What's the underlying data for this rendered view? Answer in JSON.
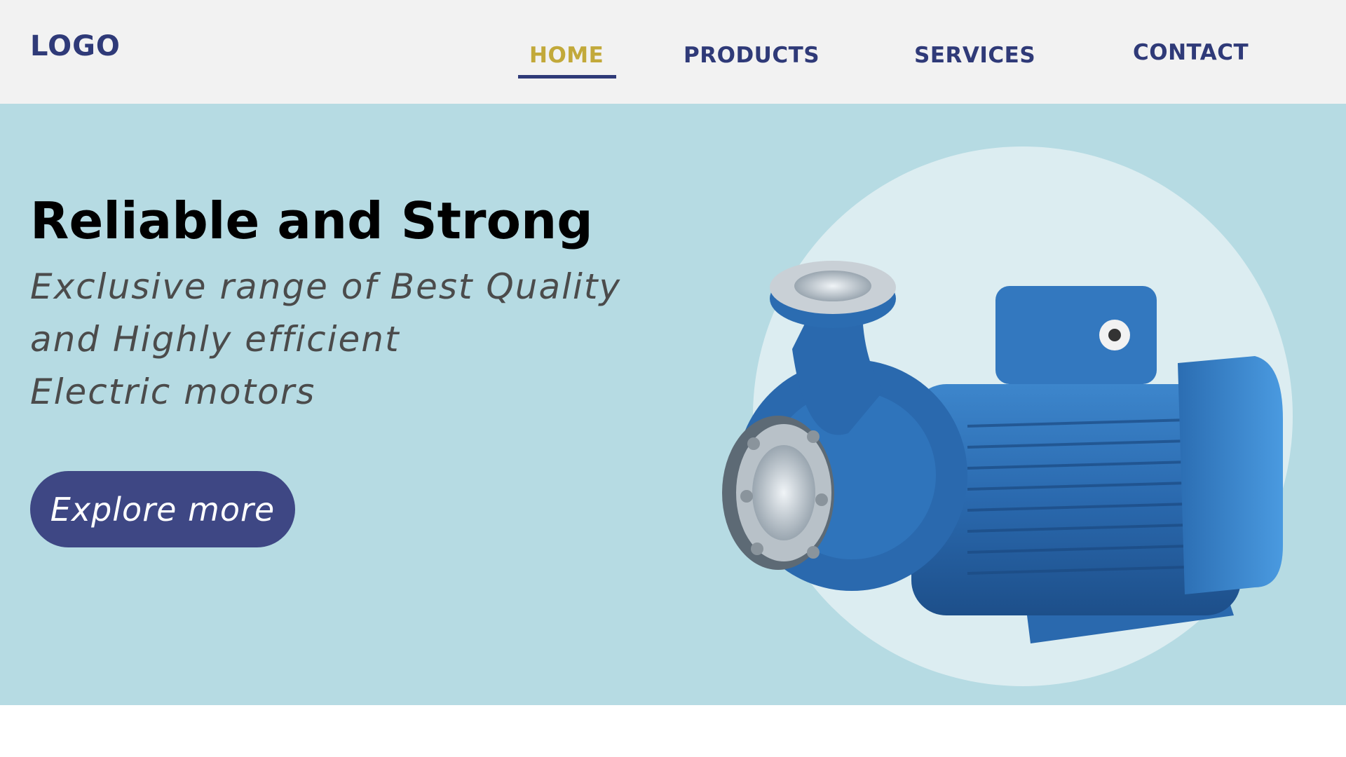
{
  "header": {
    "logo": "LOGO",
    "nav": [
      {
        "label": "HOME",
        "active": true
      },
      {
        "label": "PRODUCTS",
        "active": false
      },
      {
        "label": "SERVICES",
        "active": false
      },
      {
        "label": "CONTACT",
        "active": false
      }
    ]
  },
  "hero": {
    "title": "Reliable and Strong",
    "subtitle_lines": [
      "Exclusive range of Best Quality",
      "and Highly efficient",
      "Electric motors"
    ],
    "cta_label": "Explore more",
    "image_icon": "centrifugal-pump-motor"
  },
  "colors": {
    "header_bg": "#f2f2f2",
    "nav_text": "#2f3a78",
    "nav_active": "#c2a93a",
    "hero_bg": "#b6dbe3",
    "circle": "#dcedf1",
    "cta_bg": "#3e4784",
    "pump_blue": "#2f6fb3"
  }
}
